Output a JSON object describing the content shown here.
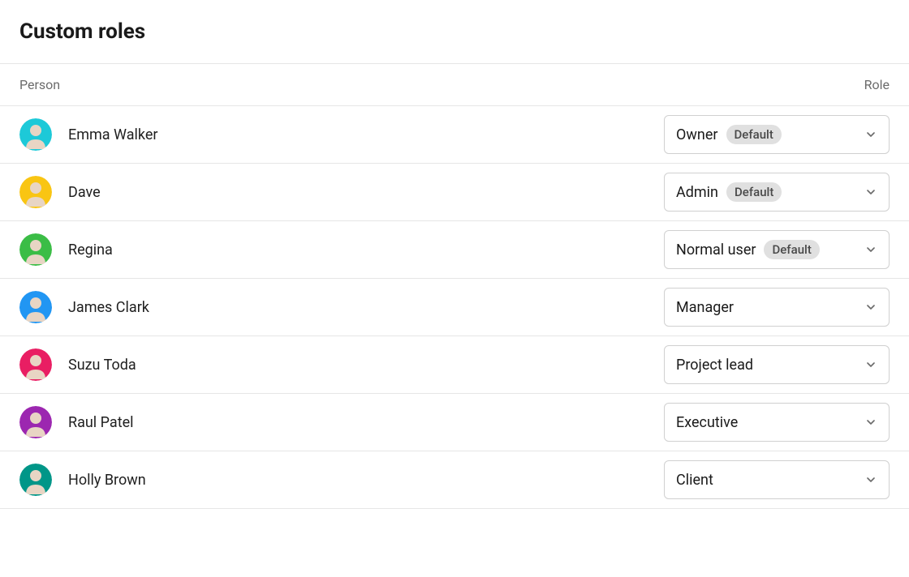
{
  "title": "Custom roles",
  "columns": {
    "person": "Person",
    "role": "Role"
  },
  "badge_default": "Default",
  "people": [
    {
      "name": "Emma Walker",
      "role": "Owner",
      "default": true,
      "avatar_bg": "#1dc9d8"
    },
    {
      "name": "Dave",
      "role": "Admin",
      "default": true,
      "avatar_bg": "#f9c513"
    },
    {
      "name": "Regina",
      "role": "Normal user",
      "default": true,
      "avatar_bg": "#3bbd46"
    },
    {
      "name": "James Clark",
      "role": "Manager",
      "default": false,
      "avatar_bg": "#2196f3"
    },
    {
      "name": "Suzu Toda",
      "role": "Project lead",
      "default": false,
      "avatar_bg": "#e91e63"
    },
    {
      "name": "Raul Patel",
      "role": "Executive",
      "default": false,
      "avatar_bg": "#9c27b0"
    },
    {
      "name": "Holly Brown",
      "role": "Client",
      "default": false,
      "avatar_bg": "#009688"
    }
  ]
}
